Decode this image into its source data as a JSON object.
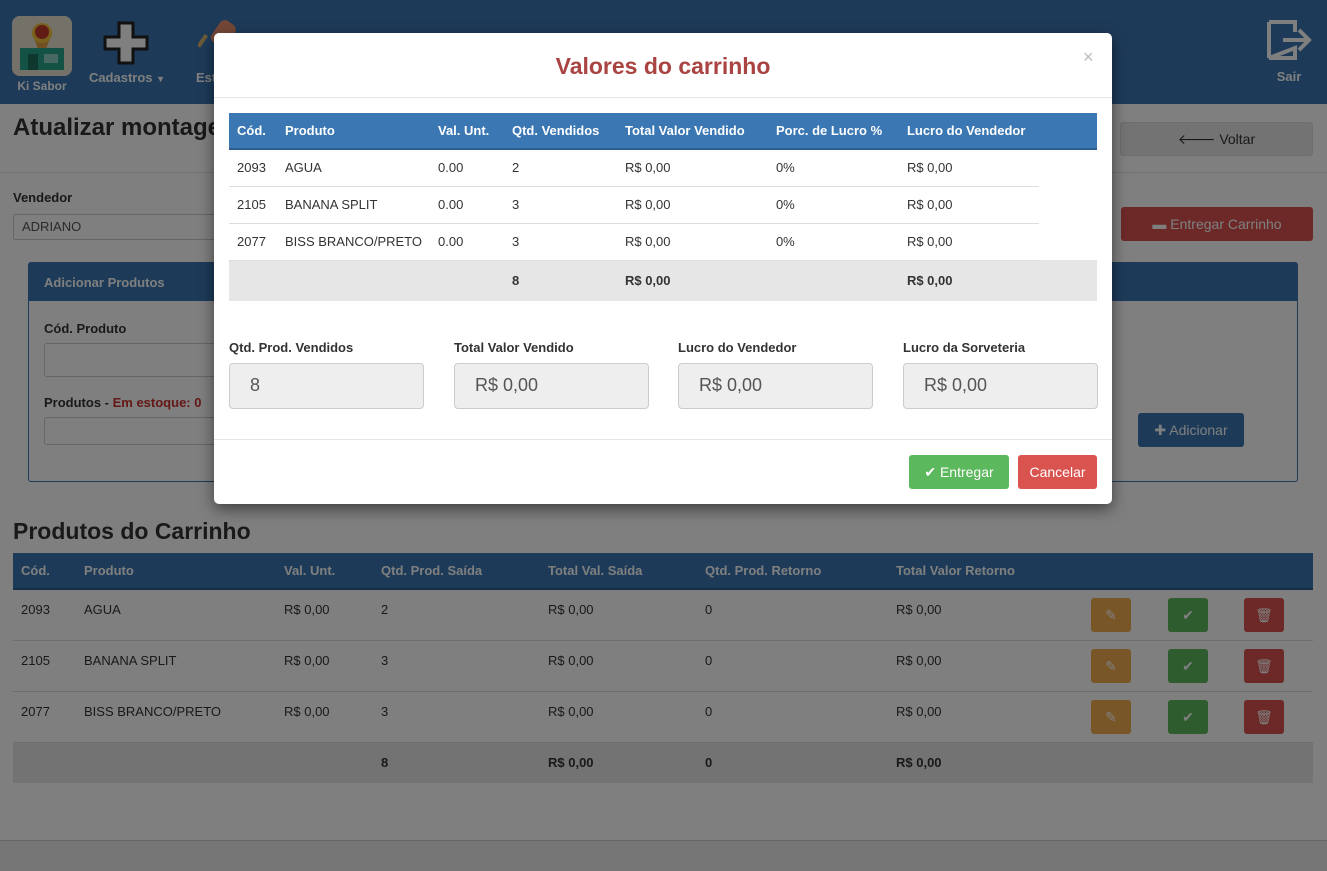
{
  "navbar": {
    "brand_label": "Ki Sabor",
    "cadastros_label": "Cadastros",
    "estoque_label_partial": "Est",
    "sair_label": "Sair"
  },
  "page": {
    "title": "Atualizar montage",
    "voltar_label": "Voltar",
    "vendedor_label": "Vendedor",
    "vendedor_value": "ADRIANO",
    "entregar_carrinho_label": "Entregar Carrinho"
  },
  "panel": {
    "title": "Adicionar Produtos",
    "cod_label": "Cód. Produto",
    "produtos_label": "Produtos - ",
    "stock_label": "Em estoque: 0",
    "adicionar_label": "Adicionar"
  },
  "cart": {
    "title": "Produtos do Carrinho",
    "headers": [
      "Cód.",
      "Produto",
      "Val. Unt.",
      "Qtd. Prod. Saída",
      "Total Val. Saída",
      "Qtd. Prod. Retorno",
      "Total Valor Retorno"
    ],
    "rows": [
      {
        "cod": "2093",
        "produto": "AGUA",
        "val_unt": "R$ 0,00",
        "qtd_saida": "2",
        "total_saida": "R$ 0,00",
        "qtd_retorno": "0",
        "total_retorno": "R$ 0,00"
      },
      {
        "cod": "2105",
        "produto": "BANANA SPLIT",
        "val_unt": "R$ 0,00",
        "qtd_saida": "3",
        "total_saida": "R$ 0,00",
        "qtd_retorno": "0",
        "total_retorno": "R$ 0,00"
      },
      {
        "cod": "2077",
        "produto": "BISS BRANCO/PRETO",
        "val_unt": "R$ 0,00",
        "qtd_saida": "3",
        "total_saida": "R$ 0,00",
        "qtd_retorno": "0",
        "total_retorno": "R$ 0,00"
      }
    ],
    "totals": {
      "qtd_saida": "8",
      "total_saida": "R$ 0,00",
      "qtd_retorno": "0",
      "total_retorno": "R$ 0,00"
    }
  },
  "modal": {
    "title": "Valores do carrinho",
    "close_label": "×",
    "headers": [
      "Cód.",
      "Produto",
      "Val. Unt.",
      "Qtd. Vendidos",
      "Total Valor Vendido",
      "Porc. de Lucro %",
      "Lucro do Vendedor"
    ],
    "rows": [
      {
        "cod": "2093",
        "produto": "AGUA",
        "val_unt": "0.00",
        "qtd": "2",
        "total": "R$ 0,00",
        "porc": "0%",
        "lucro": "R$ 0,00"
      },
      {
        "cod": "2105",
        "produto": "BANANA SPLIT",
        "val_unt": "0.00",
        "qtd": "3",
        "total": "R$ 0,00",
        "porc": "0%",
        "lucro": "R$ 0,00"
      },
      {
        "cod": "2077",
        "produto": "BISS BRANCO/PRETO",
        "val_unt": "0.00",
        "qtd": "3",
        "total": "R$ 0,00",
        "porc": "0%",
        "lucro": "R$ 0,00"
      }
    ],
    "totals": {
      "qtd": "8",
      "total": "R$ 0,00",
      "lucro": "R$ 0,00"
    },
    "summary": {
      "qtd_label": "Qtd. Prod. Vendidos",
      "qtd_value": "8",
      "total_label": "Total Valor Vendido",
      "total_value": "R$ 0,00",
      "lucro_vendedor_label": "Lucro do Vendedor",
      "lucro_vendedor_value": "R$ 0,00",
      "lucro_sorveteria_label": "Lucro da Sorveteria",
      "lucro_sorveteria_value": "R$ 0,00"
    },
    "entregar_label": "Entregar",
    "cancelar_label": "Cancelar"
  },
  "colors": {
    "primary": "#3a77b3",
    "danger": "#d9534f",
    "success": "#5cb85c",
    "warning": "#f0ad4e",
    "modal_title": "#a94442"
  },
  "icons": [
    "ice-cream-shop-logo",
    "plus-icon",
    "caret-down-icon",
    "logout-icon",
    "arrow-left-icon",
    "archive-icon",
    "plus-icon",
    "pencil-icon",
    "checklist-icon",
    "trash-icon"
  ]
}
